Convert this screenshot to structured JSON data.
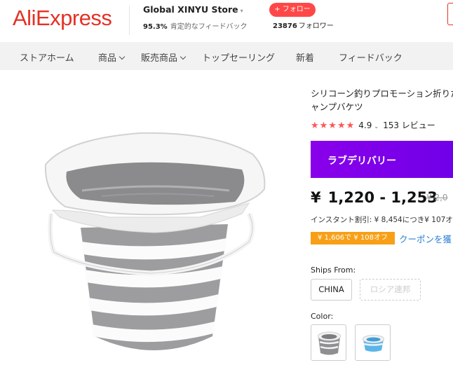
{
  "header": {
    "logo": "AliExpress",
    "store_name": "Global XINYU Store",
    "store_caret": "▾",
    "feedback_percent": "95.3%",
    "feedback_text": "肯定的なフィードバック",
    "follow_label": "+ フォロー",
    "followers_count": "23876",
    "followers_label": "フォロワー"
  },
  "nav": {
    "items": [
      "ストアホーム",
      "商品",
      "販売商品",
      "トップセーリング",
      "新着",
      "フィードバック"
    ]
  },
  "product": {
    "title_line1": "シリコーン釣りプロモーション折りた",
    "title_line2": "ャンプバケツ",
    "stars": "★★★★★",
    "rating": "4.9",
    "rating_caret": "⌄",
    "reviews": "153 レビュー",
    "banner": "ラブデリバリー",
    "price_symbol": "¥",
    "price_range": "1,220 - 1,253",
    "original_price": "2,0",
    "instant_discount": "インスタント割引: ¥ 8,454につき¥ 107オ",
    "coupon_tag": "¥ 1,606で ¥ 108オフ",
    "coupon_link": "クーポンを獲"
  },
  "shipping": {
    "label": "Ships From:",
    "options": [
      "CHINA",
      "ロシア連邦"
    ]
  },
  "color": {
    "label": "Color:",
    "swatches": [
      "gray-bucket",
      "blue-bucket"
    ]
  },
  "colors": {
    "brand": "#e43225",
    "follow": "#ff4747",
    "banner": "#7a00ea",
    "coupon": "#f7a017",
    "link": "#2a7fd4",
    "star": "#ff5555"
  }
}
